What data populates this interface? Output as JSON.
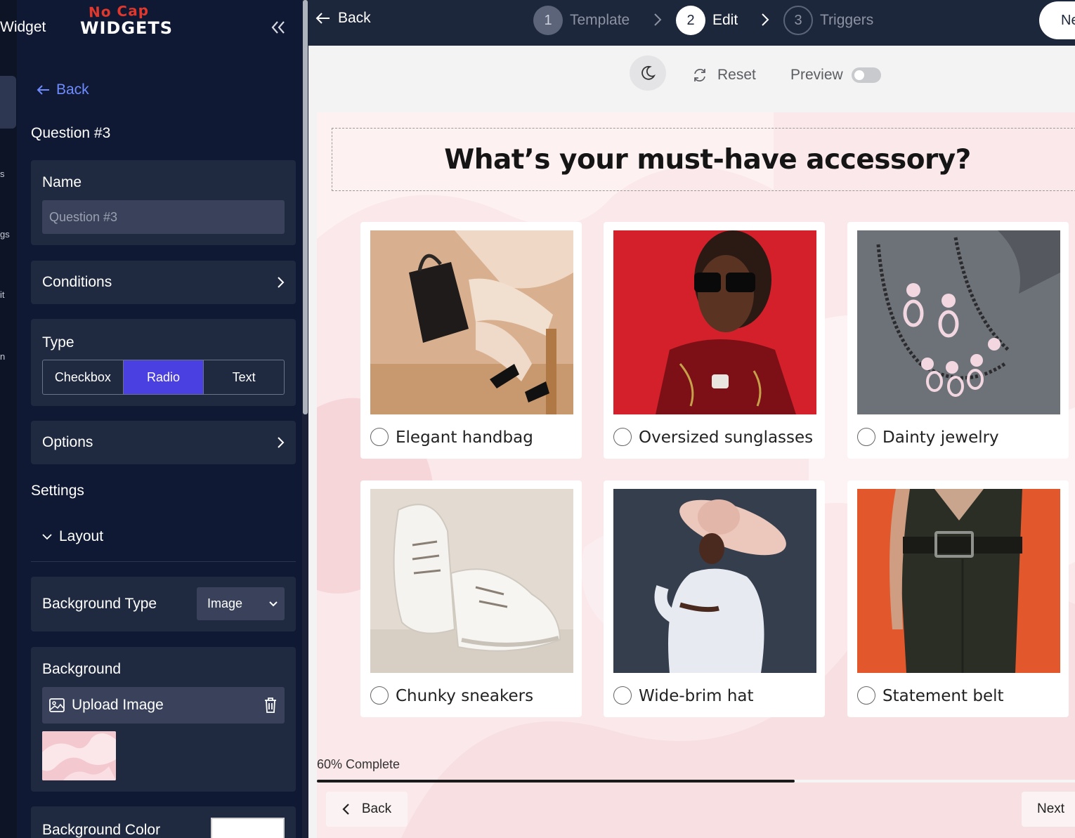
{
  "sidebar": {
    "brand_title": "Widget",
    "logo_line1": "No Cap",
    "logo_line2": "WIDGETS",
    "rail_fragments": [
      "s",
      "gs",
      "it",
      "n"
    ],
    "back_label": "Back",
    "question_heading": "Question #3",
    "name_label": "Name",
    "name_placeholder": "Question #3",
    "conditions_label": "Conditions",
    "type_label": "Type",
    "type_options": [
      "Checkbox",
      "Radio",
      "Text"
    ],
    "type_selected": "Radio",
    "options_label": "Options",
    "settings_heading": "Settings",
    "layout_label": "Layout",
    "background_type_label": "Background Type",
    "background_type_value": "Image",
    "background_label": "Background",
    "upload_label": "Upload Image",
    "background_color_label": "Background Color",
    "background_color_value": "#ffffff"
  },
  "topbar": {
    "back_label": "Back",
    "steps": [
      {
        "number": "1",
        "label": "Template"
      },
      {
        "number": "2",
        "label": "Edit"
      },
      {
        "number": "3",
        "label": "Triggers"
      }
    ],
    "active_step": "2",
    "next_label": "Ne"
  },
  "toolbar": {
    "reset_label": "Reset",
    "preview_label": "Preview",
    "preview_on": false
  },
  "quiz": {
    "question": "What’s your must-have accessory?",
    "options": [
      {
        "label": "Elegant handbag",
        "image": "handbag-photo"
      },
      {
        "label": "Oversized sunglasses",
        "image": "sunglasses-photo"
      },
      {
        "label": "Dainty jewelry",
        "image": "jewelry-photo"
      },
      {
        "label": "Chunky sneakers",
        "image": "sneakers-photo"
      },
      {
        "label": "Wide-brim hat",
        "image": "hat-photo"
      },
      {
        "label": "Statement belt",
        "image": "belt-photo"
      }
    ],
    "progress_text": "60% Complete",
    "progress_fraction": 0.63,
    "back_label": "Back",
    "next_label": "Next"
  },
  "colors": {
    "sidebar_bg": "#101933",
    "card_bg": "#1f2940",
    "accent": "#4a3fe0",
    "link": "#6f8cff",
    "topbar_bg": "#1d273b",
    "canvas_bg": "#fbe9ea"
  }
}
